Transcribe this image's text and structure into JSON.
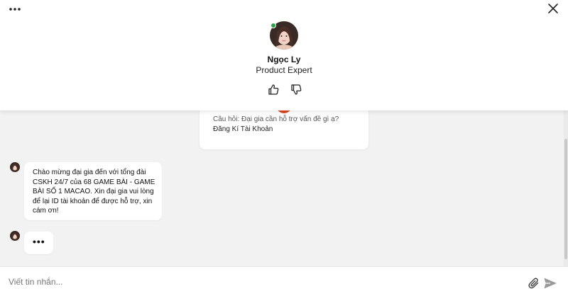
{
  "header": {
    "menu_icon": "more-horizontal-icon",
    "close_icon": "close-icon",
    "agent": {
      "name": "Ngọc Ly",
      "role": "Product Expert",
      "status_color": "#2e9e4a"
    },
    "feedback": {
      "like_icon": "thumbs-up-icon",
      "dislike_icon": "thumbs-down-icon"
    }
  },
  "chat": {
    "quick_reply_card": {
      "question": "Câu hỏi: Đại gia cần hỗ trợ vấn đề gì ạ?",
      "options": [
        "Đăng Kí Tài Khoản"
      ],
      "accent_color": "#d9481f"
    },
    "messages": [
      {
        "sender": "agent",
        "text": "Chào mừng đại gia đến với tổng đài CSKH 24/7 của 68 GAME BÀI - GAME BÀI SỐ 1 MACAO. Xin đại gia vui lòng để lại ID tài khoản để được hỗ trợ, xin cám ơn!"
      },
      {
        "sender": "agent",
        "typing": "•••"
      }
    ]
  },
  "composer": {
    "placeholder": "Viết tin nhắn...",
    "value": "",
    "attach_icon": "paperclip-icon",
    "send_icon": "send-icon"
  }
}
